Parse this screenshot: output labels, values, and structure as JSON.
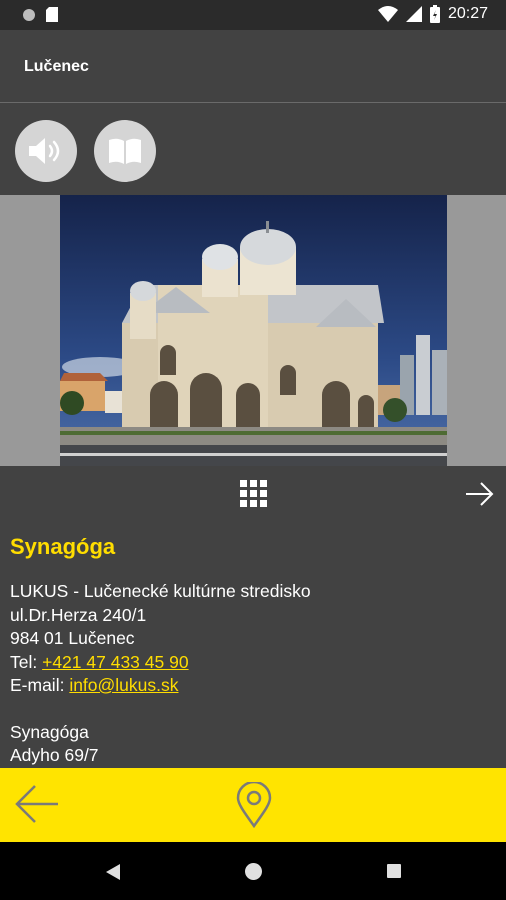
{
  "status_bar": {
    "time": "20:27"
  },
  "app_bar": {
    "title": "Lučenec"
  },
  "toolbar": {
    "audio": "speaker-icon",
    "text": "book-icon"
  },
  "place": {
    "title": "Synagóga",
    "org": "LUKUS - Lučenecké kultúrne stredisko",
    "street": "ul.Dr.Herza 240/1",
    "city": "984 01 Lučenec",
    "tel_label": "Tel: ",
    "tel": "+421 47 433 45 90",
    "email_label": "E-mail: ",
    "email": "info@lukus.sk",
    "venue": "Synagóga",
    "venue_address": "Adyho 69/7"
  },
  "colors": {
    "accent": "#ffdd00",
    "panel": "#424242",
    "bottom_bar": "#ffe400"
  }
}
